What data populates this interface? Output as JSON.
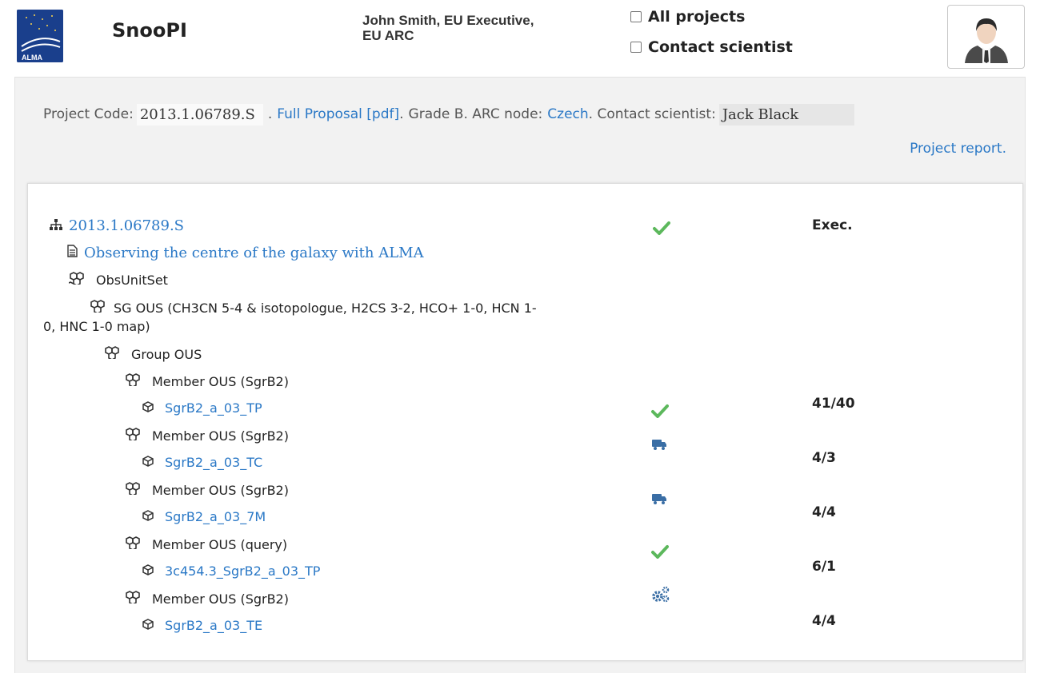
{
  "app": {
    "logo_text": "ALMA",
    "title": "SnooPI"
  },
  "user": {
    "line1": "John Smith, EU Executive,",
    "line2": "EU ARC"
  },
  "filters": {
    "all_projects": "All projects",
    "contact_scientist": "Contact scientist"
  },
  "project": {
    "code_label": "Project Code:",
    "code": "2013.1.06789.S",
    "sep1": ".",
    "proposal_link": "Full Proposal [pdf]",
    "sep2": ".",
    "grade_text": "Grade B. ARC node:",
    "arc_node": "Czech",
    "contact_label": ". Contact scientist:",
    "contact_name": "Jack Black",
    "report_link": "Project report."
  },
  "tree": {
    "root_code": "2013.1.06789.S",
    "root_status": "check",
    "root_count": "Exec.",
    "title": "Observing the centre of the galaxy with ALMA",
    "obs_unit_set": "ObsUnitSet",
    "sg_ous_line1": "SG OUS (CH3CN 5-4 & isotopologue, H2CS 3-2, HCO+ 1-0, HCN 1-",
    "sg_ous_line2": "0, HNC 1-0 map)",
    "group_ous": "Group OUS",
    "members": [
      {
        "label": "Member OUS (SgrB2)",
        "sched": "SgrB2_a_03_TP",
        "status": "check",
        "count": "41/40"
      },
      {
        "label": "Member OUS (SgrB2)",
        "sched": "SgrB2_a_03_TC",
        "status": "truck",
        "count": "4/3"
      },
      {
        "label": "Member OUS (SgrB2)",
        "sched": "SgrB2_a_03_7M",
        "status": "truck",
        "count": "4/4"
      },
      {
        "label": "Member OUS (query)",
        "sched": "3c454.3_SgrB2_a_03_TP",
        "status": "check",
        "count": "6/1"
      },
      {
        "label": "Member OUS (SgrB2)",
        "sched": "SgrB2_a_03_TE",
        "status": "gears",
        "count": "4/4"
      }
    ]
  },
  "colors": {
    "link": "#2a78c6",
    "check": "#5cb85c",
    "truck": "#3a6ea5",
    "gears": "#3a6ea5",
    "logo": "#1a3f8c"
  }
}
